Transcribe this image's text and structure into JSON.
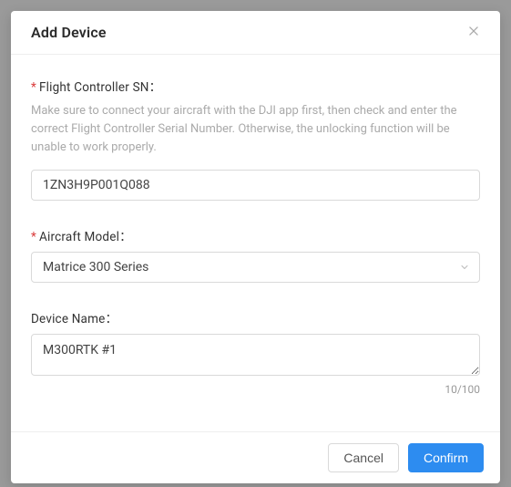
{
  "modal": {
    "title": "Add Device"
  },
  "fields": {
    "flight_sn": {
      "label": "Flight Controller SN：",
      "required_mark": "*",
      "help": "Make sure to connect your aircraft with the DJI app first, then check and enter the correct Flight Controller Serial Number. Otherwise, the unlocking function will be unable to work properly.",
      "value": "1ZN3H9P001Q088"
    },
    "aircraft_model": {
      "label": "Aircraft Model：",
      "required_mark": "*",
      "value": "Matrice 300 Series"
    },
    "device_name": {
      "label": "Device Name：",
      "value": "M300RTK #1",
      "counter": "10/100"
    }
  },
  "footer": {
    "cancel": "Cancel",
    "confirm": "Confirm"
  }
}
